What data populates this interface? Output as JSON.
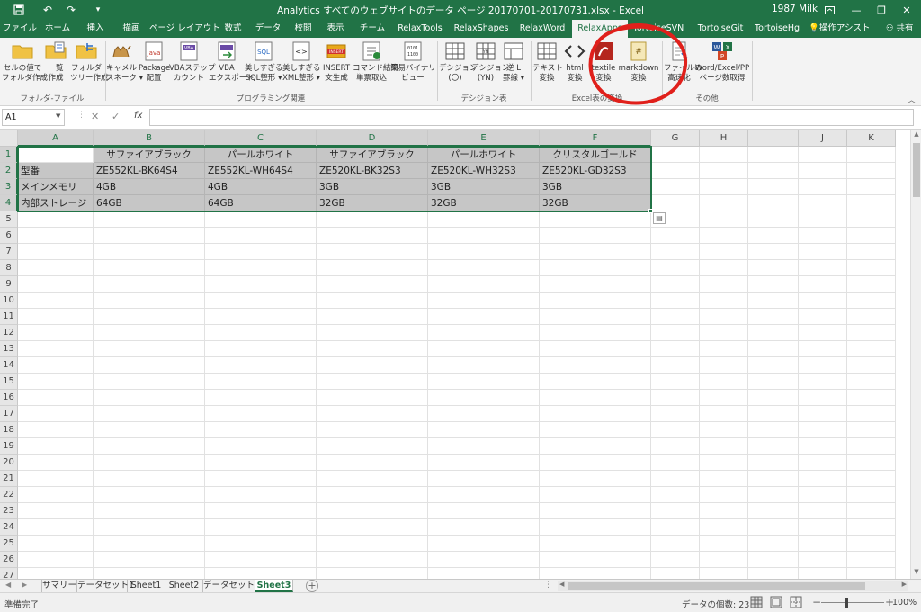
{
  "titlebar": {
    "title": "Analytics すべてのウェブサイトのデータ ページ 20170701-20170731.xlsx  -  Excel",
    "user": "1987 Milk",
    "minimize": "—",
    "restore": "❐",
    "maximize": "□",
    "close": "✕"
  },
  "tabs": [
    {
      "label": "ファイル"
    },
    {
      "label": "ホーム"
    },
    {
      "label": "挿入"
    },
    {
      "label": "描画"
    },
    {
      "label": "ページ レイアウト"
    },
    {
      "label": "数式"
    },
    {
      "label": "データ"
    },
    {
      "label": "校閲"
    },
    {
      "label": "表示"
    },
    {
      "label": "チーム"
    },
    {
      "label": "RelaxTools"
    },
    {
      "label": "RelaxShapes"
    },
    {
      "label": "RelaxWord"
    },
    {
      "label": "RelaxApps"
    },
    {
      "label": "TortoiseSVN"
    },
    {
      "label": "TortoiseGit"
    },
    {
      "label": "TortoiseHg"
    }
  ],
  "active_tab": "RelaxApps",
  "assist": "操作アシスト",
  "share": "共有",
  "ribbon": {
    "buttons": [
      {
        "label": "セルの値で\nフォルダ作成",
        "icon": "folder-icon"
      },
      {
        "label": "一覧\n作成",
        "icon": "folder-list-icon"
      },
      {
        "label": "フォルダ\nツリー作成",
        "icon": "folder-tree-icon"
      },
      {
        "label": "キャメル\nスネーク ▾",
        "icon": "camel-icon"
      },
      {
        "label": "Package\n配置",
        "icon": "java-icon"
      },
      {
        "label": "VBAステップ\nカウント",
        "icon": "vba-count-icon"
      },
      {
        "label": "VBA\nエクスポート",
        "icon": "vba-export-icon"
      },
      {
        "label": "美しすぎる\nSQL整形 ▾",
        "icon": "sql-icon"
      },
      {
        "label": "美しすぎる\nXML整形 ▾",
        "icon": "xml-icon"
      },
      {
        "label": "INSERT\n文生成",
        "icon": "insert-icon"
      },
      {
        "label": "コマンド結果\n単票取込",
        "icon": "command-icon"
      },
      {
        "label": "簡易バイナリー\nビュー",
        "icon": "binary-icon"
      },
      {
        "label": "デシジョン\n(〇)",
        "icon": "decision-o-icon"
      },
      {
        "label": "デシジョン\n(YN)",
        "icon": "decision-yn-icon"
      },
      {
        "label": "逆 L\n罫線 ▾",
        "icon": "reverse-l-icon"
      },
      {
        "label": "テキスト\n変換",
        "icon": "text-convert-icon"
      },
      {
        "label": "html\n変換",
        "icon": "html-icon"
      },
      {
        "label": "textile\n変換",
        "icon": "textile-icon"
      },
      {
        "label": "markdown\n変換",
        "icon": "markdown-icon"
      },
      {
        "label": "ファイルの\n高速化",
        "icon": "file-speed-icon"
      },
      {
        "label": "Word/Excel/PP\nページ数取得",
        "icon": "office-pages-icon"
      }
    ],
    "groups": [
      {
        "label": "フォルダ-ファイル"
      },
      {
        "label": "プログラミング関連"
      },
      {
        "label": "デシジョン表"
      },
      {
        "label": "Excel表の変換"
      },
      {
        "label": "その他"
      }
    ]
  },
  "formula_bar": {
    "name_box": "A1",
    "cancel": "✕",
    "enter": "✓",
    "fx": "fx",
    "value": ""
  },
  "grid": {
    "columns": [
      "A",
      "B",
      "C",
      "D",
      "E",
      "F",
      "G",
      "H",
      "I",
      "J",
      "K"
    ],
    "rows": [
      "1",
      "2",
      "3",
      "4",
      "5",
      "6",
      "7",
      "8",
      "9",
      "10",
      "11",
      "12",
      "13",
      "14",
      "15",
      "16",
      "17",
      "18",
      "19",
      "20",
      "21",
      "22",
      "23",
      "24",
      "25",
      "26",
      "27"
    ],
    "cells": [
      [
        "",
        "サファイアブラック",
        "パールホワイト",
        "サファイアブラック",
        "パールホワイト",
        "クリスタルゴールド"
      ],
      [
        "型番",
        "ZE552KL-BK64S4",
        "ZE552KL-WH64S4",
        "ZE520KL-BK32S3",
        "ZE520KL-WH32S3",
        "ZE520KL-GD32S3"
      ],
      [
        "メインメモリ",
        "4GB",
        "4GB",
        "3GB",
        "3GB",
        "3GB"
      ],
      [
        "内部ストレージ",
        "64GB",
        "64GB",
        "32GB",
        "32GB",
        "32GB"
      ]
    ],
    "fill_color": "#c6c6c6",
    "selection_color": "#217346"
  },
  "sheets": [
    {
      "label": "サマリー"
    },
    {
      "label": "データセット1"
    },
    {
      "label": "Sheet1"
    },
    {
      "label": "Sheet2"
    },
    {
      "label": "データセット2"
    },
    {
      "label": "Sheet3"
    }
  ],
  "active_sheet": "Sheet3",
  "status": {
    "ready": "準備完了",
    "count": "データの個数: 23",
    "zoom": "100%"
  },
  "colors": {
    "excel_green": "#217346",
    "annotation_red": "#e0201b"
  }
}
